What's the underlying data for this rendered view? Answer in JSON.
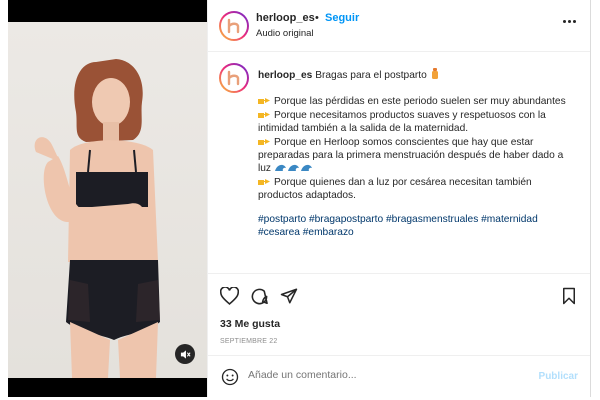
{
  "post": {
    "username": "herloop_es",
    "separator": "•",
    "follow_label": "Seguir",
    "audio_label": "Audio original",
    "caption_title": "Bragas para el postparto",
    "bullets": [
      "Porque las pérdidas en este periodo suelen ser muy abundantes",
      "Porque necesitamos productos suaves y respetuosos con la intimidad también a la salida de la maternidad.",
      "Porque en Herloop somos conscientes que hay que estar preparadas para la primera menstruación después de haber dado a luz",
      "Porque quienes dan a luz por cesárea necesitan también productos adaptados."
    ],
    "hashtags": "#postparto #bragapostparto #bragasmenstruales #maternidad #cesarea #embarazo",
    "likes": "33 Me gusta",
    "date": "SEPTIEMBRE 22",
    "comment_placeholder": "Añade un comentario...",
    "publish_label": "Publicar"
  },
  "icons": [
    "more-options-icon",
    "heart-icon",
    "comment-icon",
    "share-icon",
    "bookmark-icon",
    "emoji-icon",
    "muted-speaker-icon",
    "pointing-hand-icon",
    "baby-bottle-icon",
    "wave-icon"
  ],
  "colors": {
    "accent": "#0095f6",
    "publish_disabled": "#b2dffc",
    "hashtag": "#00376b",
    "logo_brand": "#e9a07a"
  }
}
